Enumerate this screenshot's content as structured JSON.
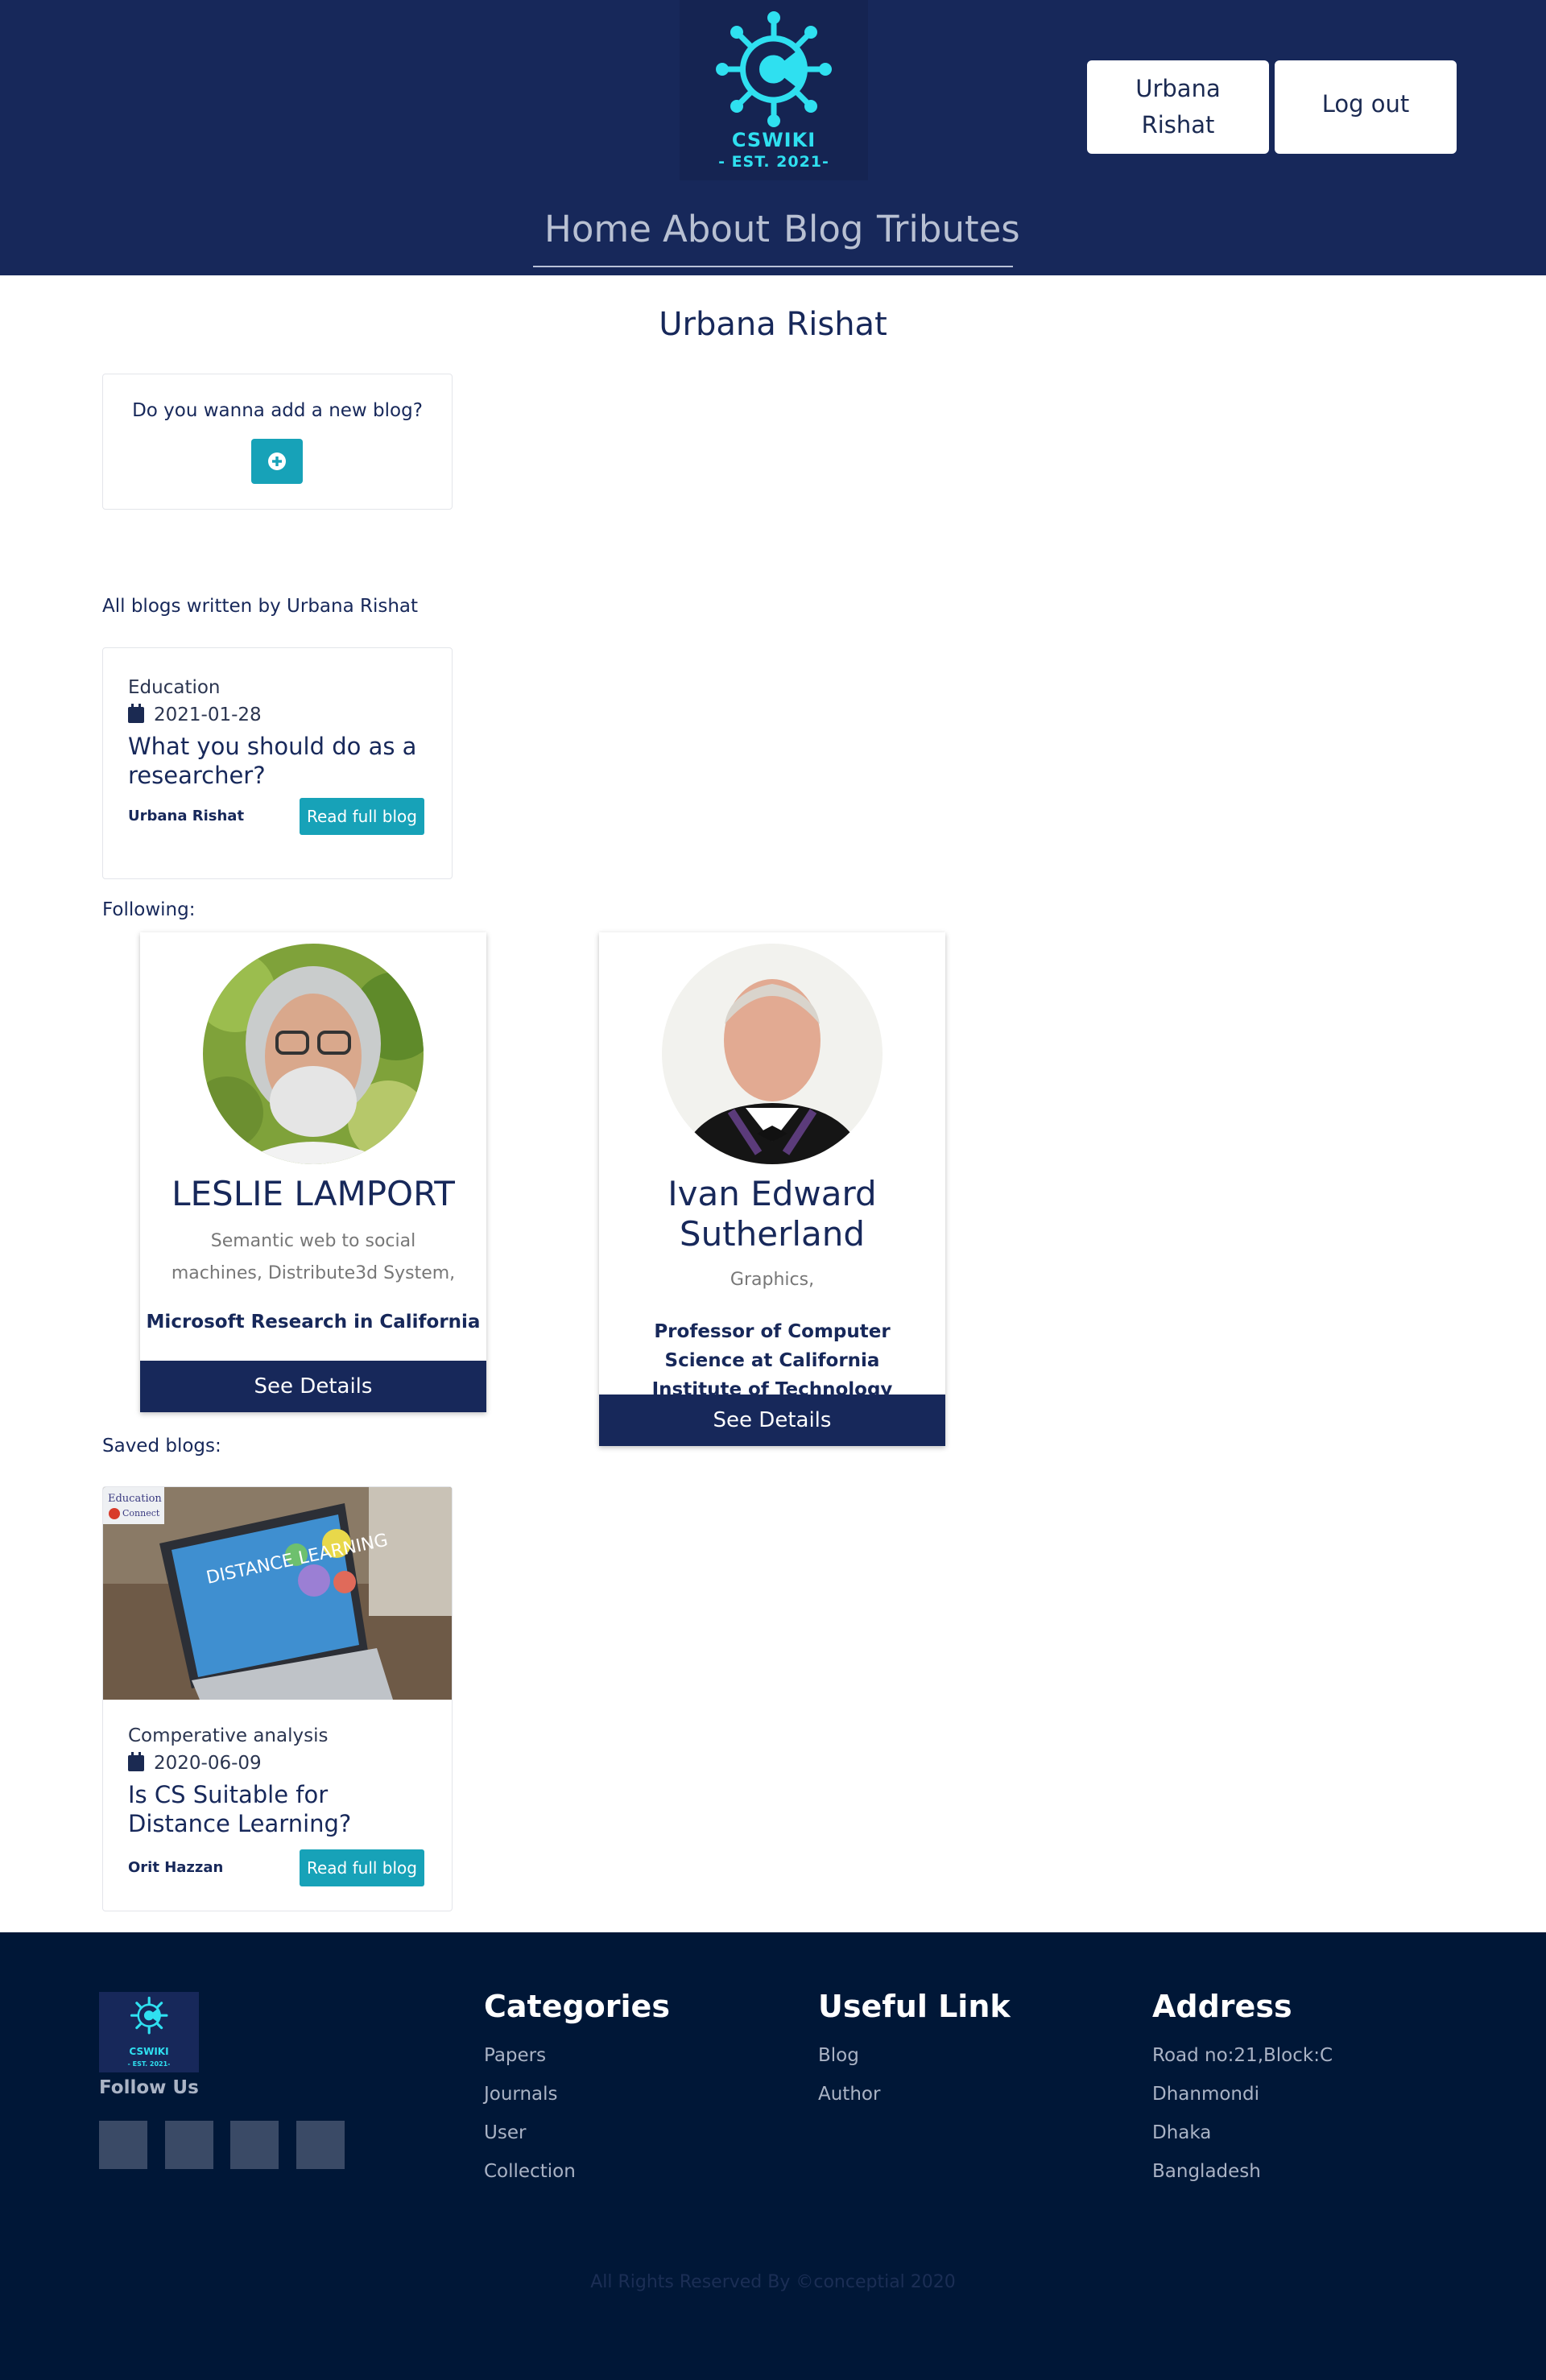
{
  "header": {
    "logo": {
      "name": "CSWIKI",
      "tagline": "- EST. 2021-"
    },
    "user_button": "Urbana Rishat",
    "logout_button": "Log out",
    "nav": [
      "Home",
      "About",
      "Blog",
      "Tributes"
    ]
  },
  "page_title": "Urbana Rishat",
  "add_blog": {
    "question": "Do you wanna add a new blog?",
    "icon": "plus-circle-icon"
  },
  "my_blogs": {
    "label": "All blogs written by Urbana Rishat",
    "items": [
      {
        "category": "Education",
        "date": "2021-01-28",
        "title": "What you should do as a researcher?",
        "author": "Urbana Rishat",
        "button": "Read full blog"
      }
    ]
  },
  "following": {
    "label": "Following:",
    "people": [
      {
        "name": "LESLIE LAMPORT",
        "topics": "Semantic web to social machines, Distribute3d System,",
        "org": "Microsoft Research in California",
        "button": "See Details"
      },
      {
        "name": "Ivan Edward Sutherland",
        "topics": "Graphics,",
        "org": "Professor of Computer Science at California Institute of Technology",
        "button": "See Details"
      }
    ]
  },
  "saved_blogs": {
    "label": "Saved blogs:",
    "items": [
      {
        "image_text": "DISTANCE LEARNING",
        "image_badge_line1": "Education",
        "image_badge_line2": "Connect",
        "category": "Comperative analysis",
        "date": "2020-06-09",
        "title": "Is CS Suitable for Distance Learning?",
        "author": "Orit Hazzan",
        "button": "Read full blog"
      }
    ]
  },
  "footer": {
    "logo": {
      "name": "CSWIKI",
      "tagline": "- EST. 2021-"
    },
    "follow_us": "Follow Us",
    "categories": {
      "title": "Categories",
      "links": [
        "Papers",
        "Journals",
        "User",
        "Collection"
      ]
    },
    "useful": {
      "title": "Useful Link",
      "links": [
        "Blog",
        "Author"
      ]
    },
    "address": {
      "title": "Address",
      "lines": [
        "Road no:21,Block:C",
        "Dhanmondi",
        "Dhaka",
        "Bangladesh"
      ]
    },
    "copyright": "All Rights Reserved By ©conceptial 2020"
  },
  "colors": {
    "navy": "#17285a",
    "teal": "#17a2b8",
    "logo_cyan": "#2fe0f0",
    "footer_bg": "#001737"
  }
}
